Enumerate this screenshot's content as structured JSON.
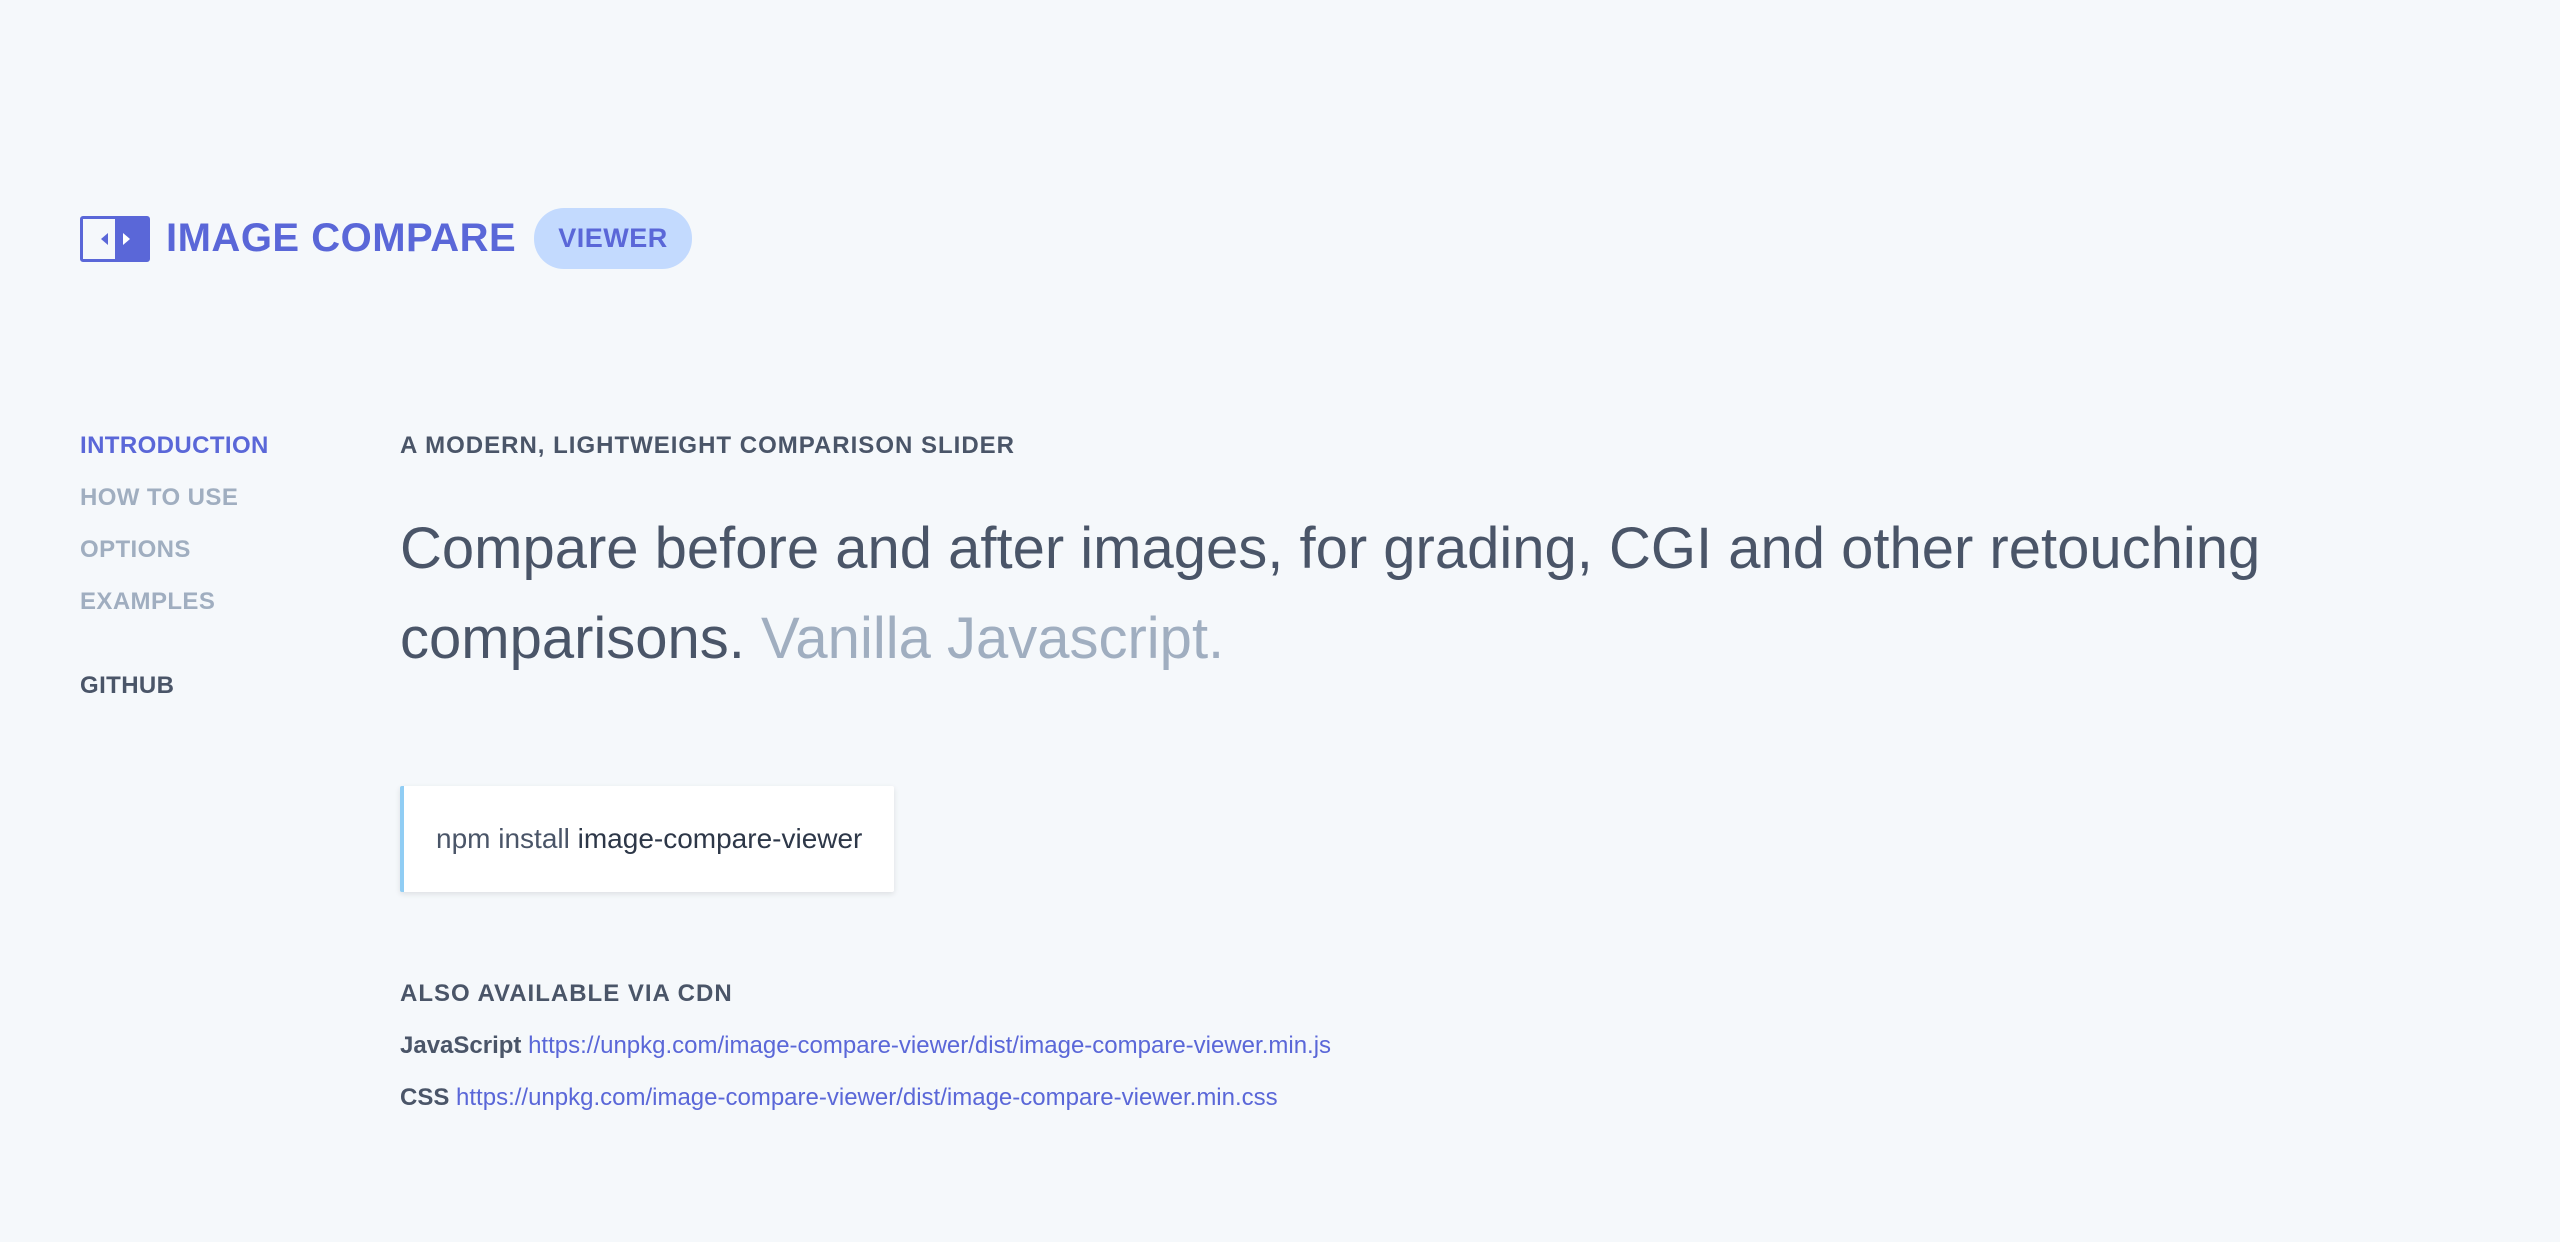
{
  "brand": {
    "icon": "image-compare-logo-icon",
    "title": "IMAGE COMPARE",
    "badge": "VIEWER",
    "accent": "#5a67d8",
    "badge_bg": "#c3dafe"
  },
  "sidebar": {
    "items": [
      {
        "label": "INTRODUCTION",
        "active": true
      },
      {
        "label": "HOW TO USE",
        "active": false
      },
      {
        "label": "OPTIONS",
        "active": false
      },
      {
        "label": "EXAMPLES",
        "active": false
      }
    ],
    "github_label": "GITHUB"
  },
  "main": {
    "eyebrow": "A MODERN, LIGHTWEIGHT COMPARISON SLIDER",
    "lead": "Compare before and after images, for grading, CGI and other retouching comparisons.",
    "lead_muted": "Vanilla Javascript.",
    "install": {
      "command": "npm install",
      "package": "image-compare-viewer"
    },
    "cdn": {
      "heading": "ALSO AVAILABLE VIA CDN",
      "links": [
        {
          "label": "JavaScript",
          "url": "https://unpkg.com/image-compare-viewer/dist/image-compare-viewer.min.js"
        },
        {
          "label": "CSS",
          "url": "https://unpkg.com/image-compare-viewer/dist/image-compare-viewer.min.css"
        }
      ]
    }
  }
}
